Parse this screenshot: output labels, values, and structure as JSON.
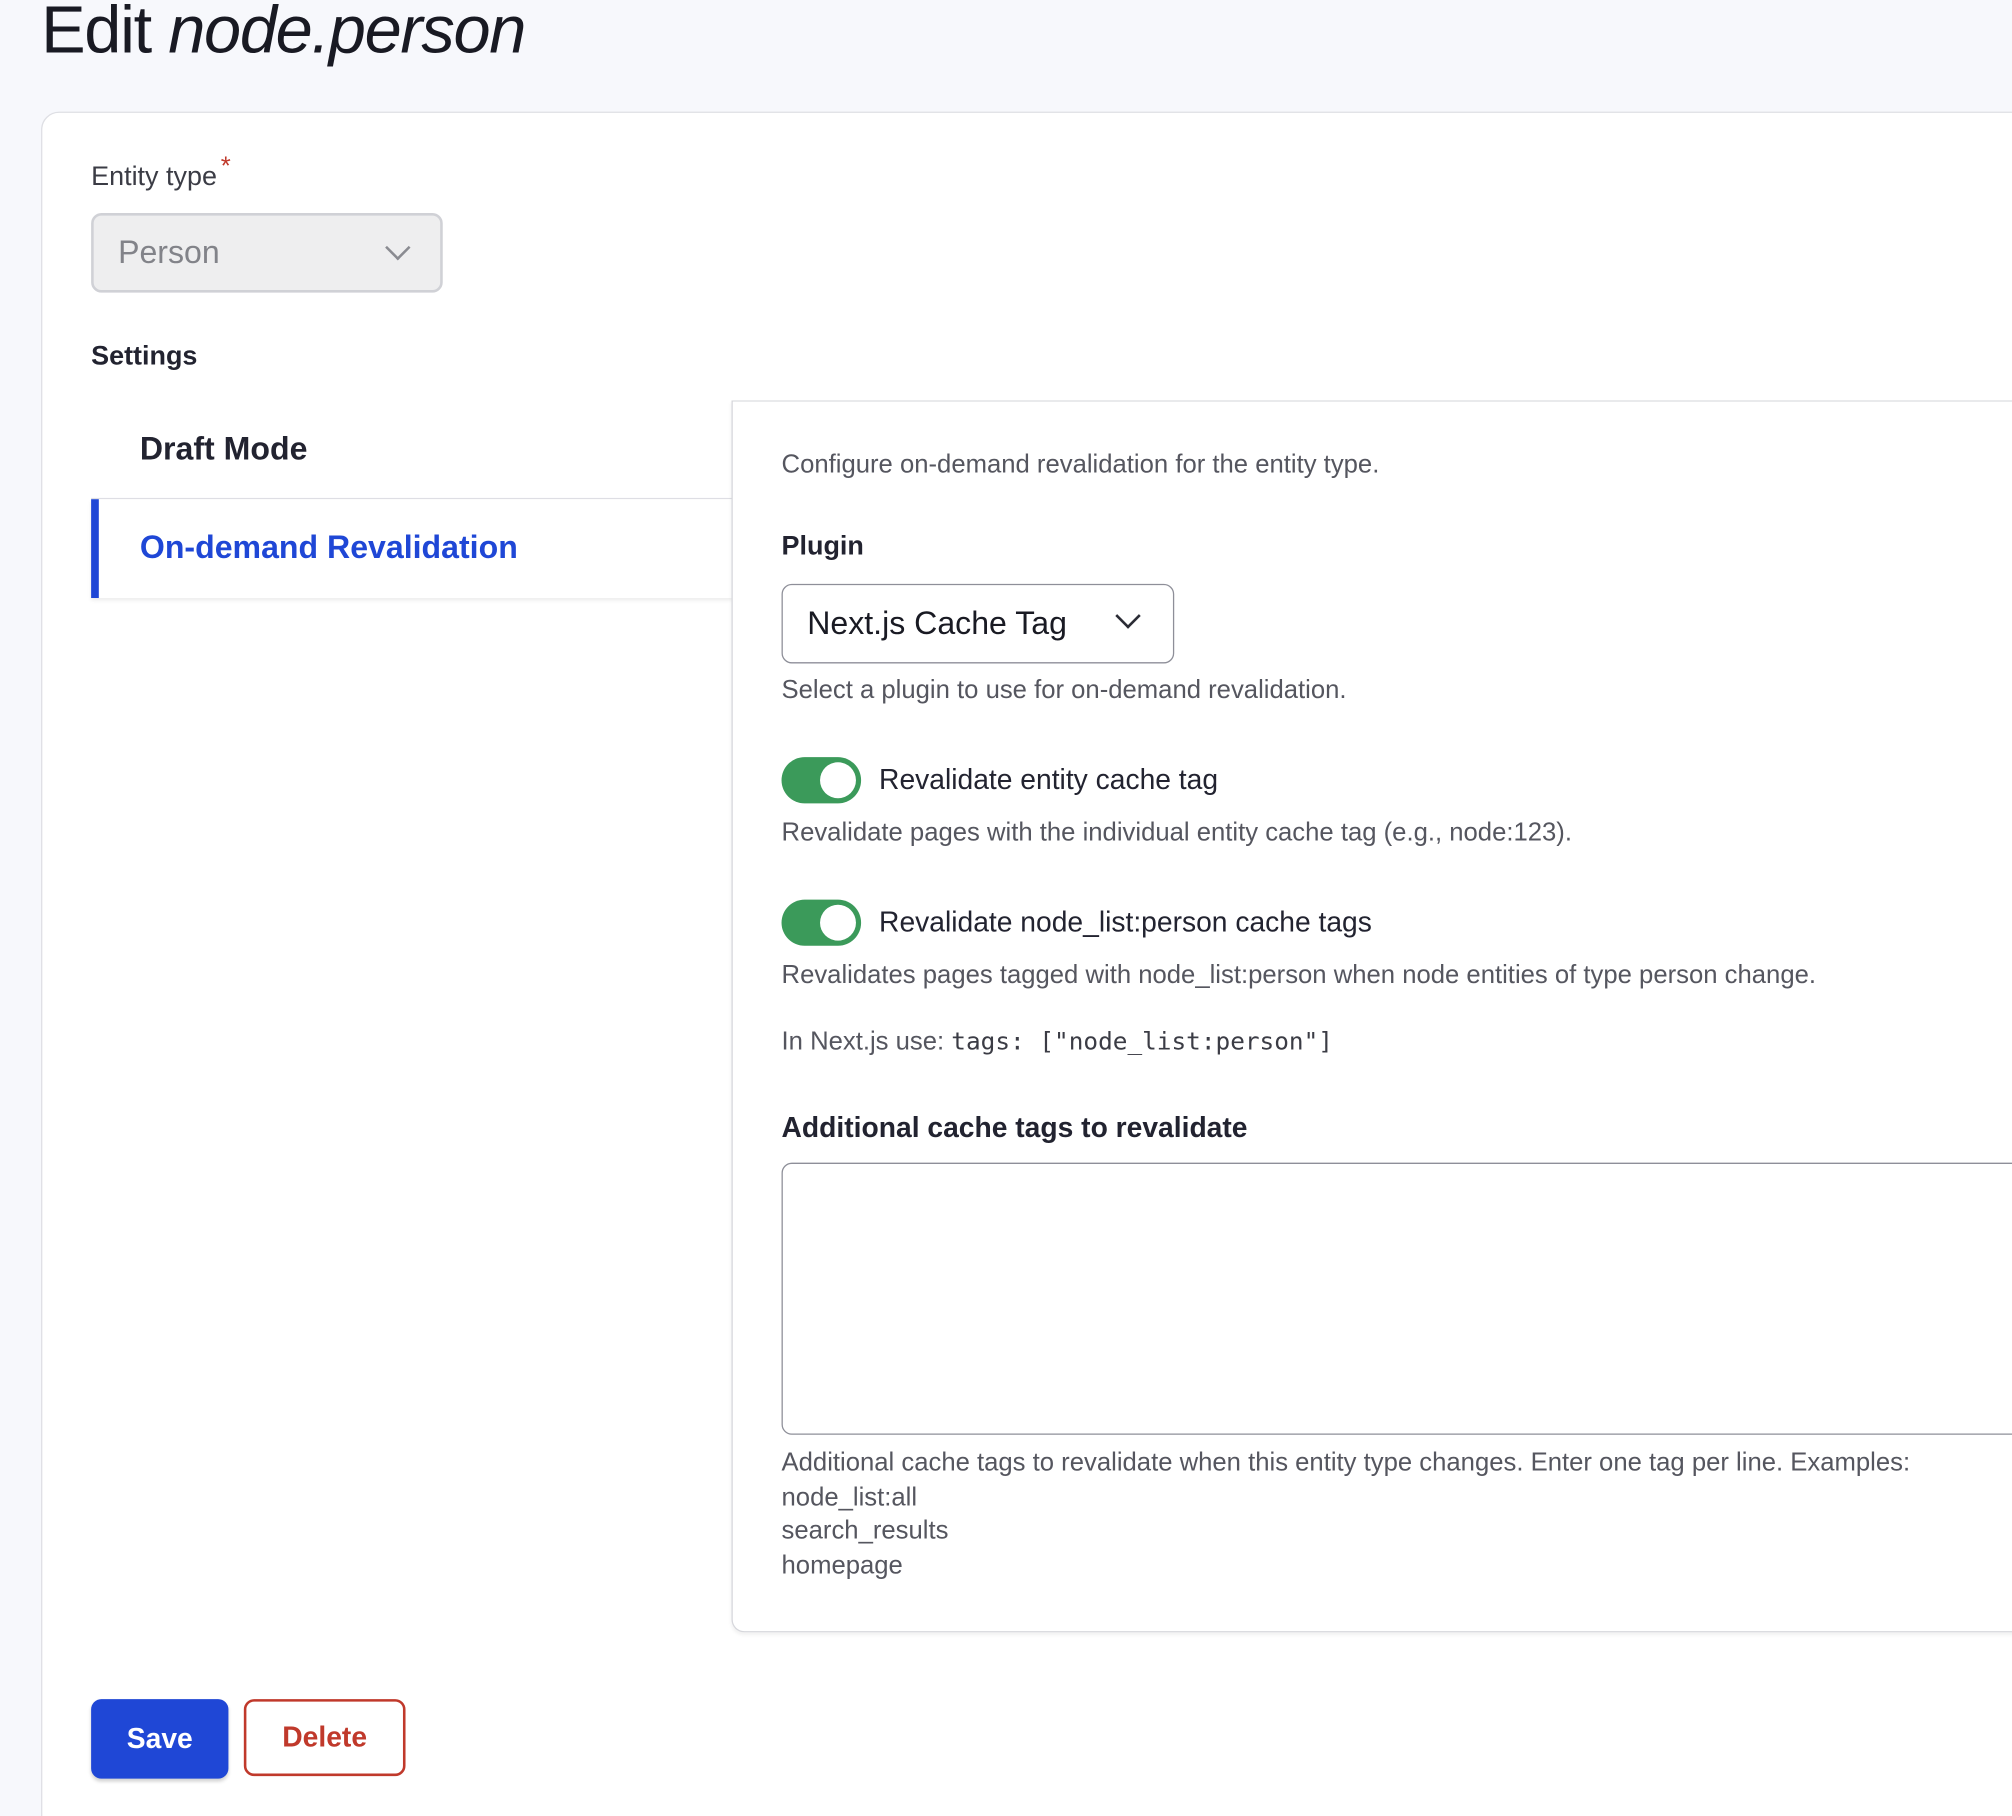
{
  "page": {
    "title_prefix": "Edit",
    "title_entity": "node.person"
  },
  "entity_type": {
    "label": "Entity type",
    "required_mark": "*",
    "value": "Person"
  },
  "settings": {
    "label": "Settings",
    "tabs": [
      {
        "label": "Draft Mode",
        "active": false
      },
      {
        "label": "On-demand Revalidation",
        "active": true
      }
    ]
  },
  "panel": {
    "intro": "Configure on-demand revalidation for the entity type.",
    "plugin": {
      "label": "Plugin",
      "value": "Next.js Cache Tag",
      "description": "Select a plugin to use for on-demand revalidation."
    },
    "toggles": [
      {
        "label": "Revalidate entity cache tag",
        "checked": true,
        "description": "Revalidate pages with the individual entity cache tag (e.g., node:123)."
      },
      {
        "label": "Revalidate node_list:person cache tags",
        "checked": true,
        "description": "Revalidates pages tagged with node_list:person when node entities of type person change."
      }
    ],
    "nextjs_hint": {
      "prefix": "In Next.js use:",
      "code": "tags: [\"node_list:person\"]"
    },
    "additional": {
      "label": "Additional cache tags to revalidate",
      "value": "",
      "help": "Additional cache tags to revalidate when this entity type changes. Enter one tag per line. Examples:",
      "examples": [
        "node_list:all",
        "search_results",
        "homepage"
      ]
    }
  },
  "actions": {
    "save_label": "Save",
    "delete_label": "Delete"
  },
  "colors": {
    "accent": "#1f47d6",
    "danger": "#c0392b",
    "toggle_on": "#3b9a5a"
  }
}
